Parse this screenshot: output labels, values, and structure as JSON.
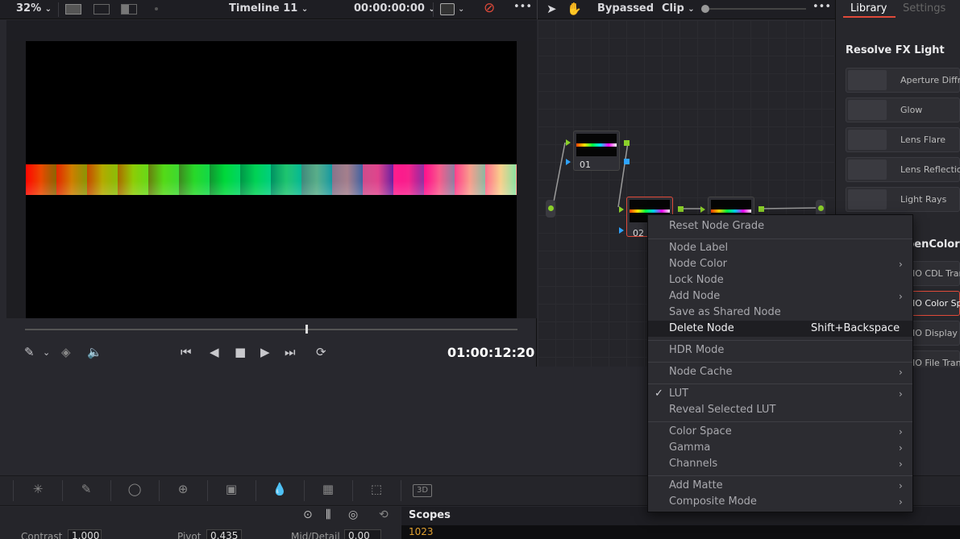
{
  "topbar": {
    "zoom": "32%",
    "timeline": "Timeline 11",
    "timecode": "00:00:00:00",
    "bypassed": "Bypassed",
    "clip": "Clip",
    "more": "•••",
    "more2": "•••"
  },
  "library": {
    "tabs": [
      "Library",
      "Settings"
    ],
    "section_title": "Resolve FX Light",
    "items": [
      "Aperture Diffra",
      "Glow",
      "Lens Flare",
      "Lens Reflection",
      "Light Rays"
    ],
    "section2_title": "penColorI",
    "items2": [
      "IO CDL Tran",
      "IO Color Spa",
      "IO Display",
      "IO File Tran"
    ]
  },
  "viewer": {
    "timecode": "01:00:12:20"
  },
  "nodes": {
    "labels": [
      "01",
      "02"
    ]
  },
  "context_menu": {
    "items": [
      {
        "label": "Reset Node Grade"
      },
      {
        "label": "Node Label"
      },
      {
        "label": "Node Color",
        "submenu": true
      },
      {
        "label": "Lock Node"
      },
      {
        "label": "Add Node",
        "submenu": true
      },
      {
        "label": "Save as Shared Node"
      },
      {
        "label": "Delete Node",
        "shortcut": "Shift+Backspace",
        "highlighted": true
      },
      {
        "label": "HDR Mode"
      },
      {
        "label": "Node Cache",
        "submenu": true
      },
      {
        "label": "LUT",
        "submenu": true,
        "checked": true
      },
      {
        "label": "Reveal Selected LUT"
      },
      {
        "label": "Color Space",
        "submenu": true
      },
      {
        "label": "Gamma",
        "submenu": true
      },
      {
        "label": "Channels",
        "submenu": true
      },
      {
        "label": "Add Matte",
        "submenu": true
      },
      {
        "label": "Composite Mode",
        "submenu": true
      }
    ]
  },
  "bottom": {
    "contrast_label": "Contrast",
    "contrast_value": "1.000",
    "pivot_label": "Pivot",
    "pivot_value": "0.435",
    "middetail_label": "Mid/Detail",
    "middetail_value": "0.00",
    "scopes_title": "Scopes",
    "scopes_value": "1023"
  },
  "colors": {
    "accent_red": "#e04a3a",
    "port_green": "#8bd02a",
    "port_blue": "#2ea3ff"
  }
}
